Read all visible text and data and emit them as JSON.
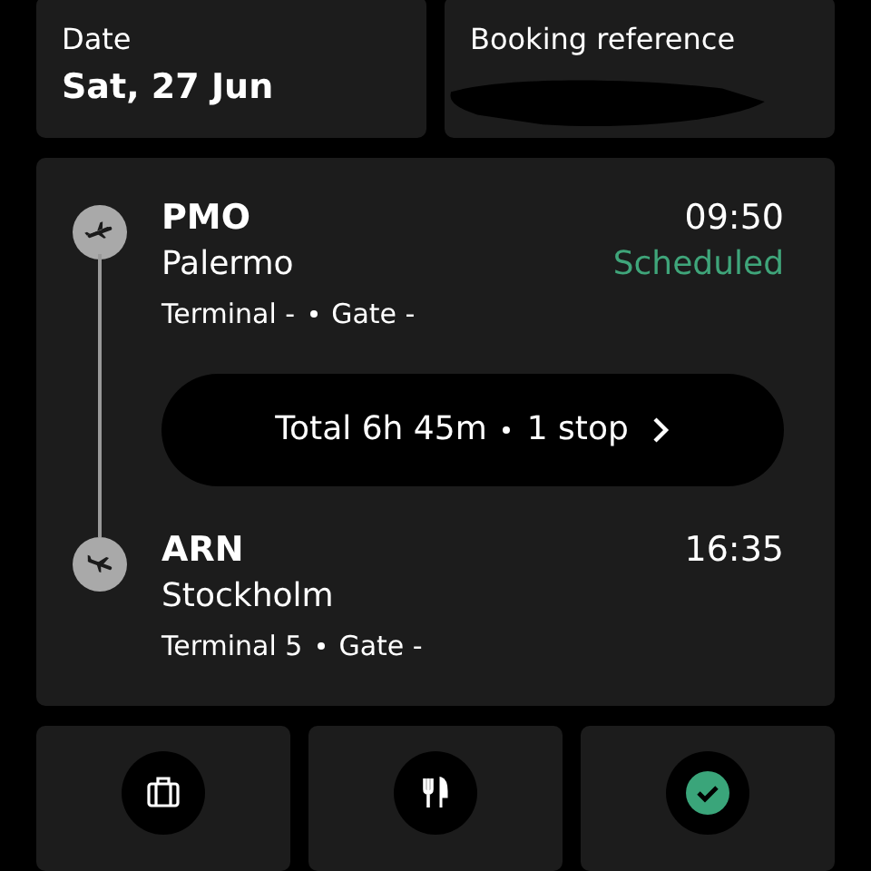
{
  "info_cards": [
    {
      "label": "Date",
      "value": "Sat, 27 Jun"
    },
    {
      "label": "Booking reference",
      "redacted": true
    }
  ],
  "flight": {
    "segments": [
      {
        "kind": "departure",
        "code": "PMO",
        "city": "Palermo",
        "time": "09:50",
        "status": "Scheduled",
        "terminal": "Terminal -",
        "gate": "Gate -"
      },
      {
        "kind": "arrival",
        "code": "ARN",
        "city": "Stockholm",
        "time": "16:35",
        "terminal": "Terminal 5",
        "gate": "Gate -"
      }
    ],
    "summary": {
      "duration": "Total 6h 45m",
      "stops": "1 stop"
    }
  },
  "actions": [
    {
      "kind": "baggage"
    },
    {
      "kind": "meal"
    },
    {
      "kind": "checkin",
      "done": true
    }
  ]
}
